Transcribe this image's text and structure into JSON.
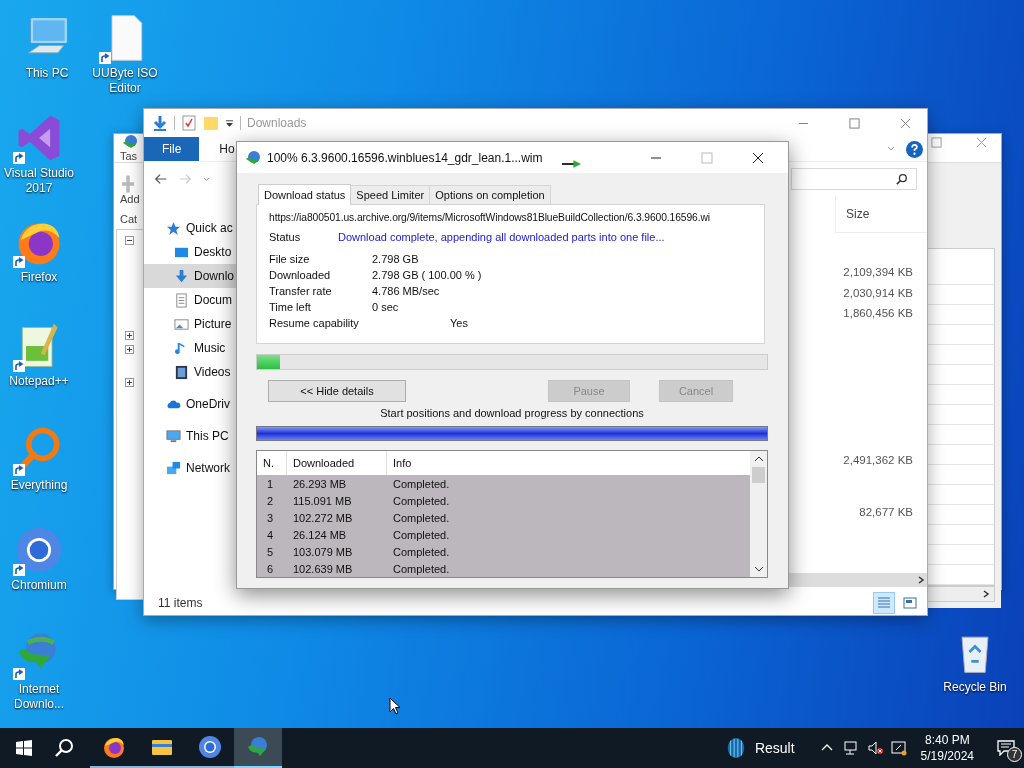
{
  "desktop": {
    "icons": [
      {
        "label": "This PC",
        "kind": "computer",
        "shortcut": false
      },
      {
        "label": "UUByte ISO Editor",
        "kind": "document",
        "shortcut": true
      },
      {
        "label": "Visual Studio 2017",
        "kind": "visual-studio",
        "shortcut": true
      },
      {
        "label": "Firefox",
        "kind": "firefox",
        "shortcut": true
      },
      {
        "label": "Notepad++",
        "kind": "notepad",
        "shortcut": true
      },
      {
        "label": "Everything",
        "kind": "magnifier",
        "shortcut": true
      },
      {
        "label": "Chromium",
        "kind": "chromium",
        "shortcut": true
      },
      {
        "label": "Internet Downlo...",
        "kind": "downloader",
        "shortcut": true
      },
      {
        "label": "Recycle Bin",
        "kind": "recycle-bin",
        "shortcut": false
      }
    ]
  },
  "background_window": {
    "toolbar_label": "Tas",
    "add_label": "Add",
    "categories_label": "Cat",
    "tree_nodes": [
      {
        "expanded": true
      },
      {
        "expanded": false
      },
      {
        "expanded": false
      },
      {
        "expanded": false
      }
    ]
  },
  "explorer": {
    "title": "Downloads",
    "ribbon_tabs": [
      {
        "label": "File",
        "selected": true
      },
      {
        "label": "Ho",
        "selected": false
      }
    ],
    "nav_items": [
      {
        "label": "Quick ac",
        "kind": "star",
        "selected": false
      },
      {
        "label": "Deskto",
        "kind": "desktop",
        "selected": false
      },
      {
        "label": "Downlo",
        "kind": "download",
        "selected": true
      },
      {
        "label": "Docum",
        "kind": "document",
        "selected": false
      },
      {
        "label": "Picture",
        "kind": "pictures",
        "selected": false
      },
      {
        "label": "Music",
        "kind": "music",
        "selected": false
      },
      {
        "label": "Videos",
        "kind": "videos",
        "selected": false
      },
      {
        "label": "OneDriv",
        "kind": "cloud",
        "selected": false
      },
      {
        "label": "This PC",
        "kind": "computer",
        "selected": false
      },
      {
        "label": "Network",
        "kind": "network",
        "selected": false
      }
    ],
    "column_header": "Size",
    "sizes": [
      "2,109,394 KB",
      "2,030,914 KB",
      "1,860,456 KB",
      "2,491,362 KB",
      "82,677 KB"
    ],
    "status": "11 items"
  },
  "dialog": {
    "title": "100% 6.3.9600.16596.winblues14_gdr_lean.1...wim",
    "tabs": [
      {
        "label": "Download status",
        "selected": true
      },
      {
        "label": "Speed Limiter",
        "selected": false
      },
      {
        "label": "Options on completion",
        "selected": false
      }
    ],
    "url": "https://ia800501.us.archive.org/9/items/MicrosoftWindows81BlueBuildCollection/6.3.9600.16596.wi",
    "status_label": "Status",
    "status_value": "Download complete, appending all downloaded parts into one file...",
    "info": [
      {
        "label": "File size",
        "value": "2.798  GB"
      },
      {
        "label": "Downloaded",
        "value": "2.798  GB  ( 100.00 % )"
      },
      {
        "label": "Transfer rate",
        "value": "4.786  MB/sec"
      },
      {
        "label": "Time left",
        "value": "0 sec"
      }
    ],
    "resume_label": "Resume capability",
    "resume_value": "Yes",
    "progress": {
      "level": 0.045
    },
    "buttons": [
      {
        "label": "<< Hide details",
        "disabled": false
      },
      {
        "label": "Pause",
        "disabled": true
      },
      {
        "label": "Cancel",
        "disabled": true
      }
    ],
    "connections_caption": "Start positions and download progress by connections",
    "table": {
      "columns": [
        "N.",
        "Downloaded",
        "Info"
      ],
      "rows": [
        {
          "n": "1",
          "downloaded": "26.293  MB",
          "info": "Completed.",
          "selected": true
        },
        {
          "n": "2",
          "downloaded": "115.091  MB",
          "info": "Completed.",
          "selected": true
        },
        {
          "n": "3",
          "downloaded": "102.272  MB",
          "info": "Completed.",
          "selected": true
        },
        {
          "n": "4",
          "downloaded": "26.124  MB",
          "info": "Completed.",
          "selected": true
        },
        {
          "n": "5",
          "downloaded": "103.079  MB",
          "info": "Completed.",
          "selected": true
        },
        {
          "n": "6",
          "downloaded": "102.639  MB",
          "info": "Completed.",
          "selected": true
        }
      ]
    }
  },
  "taskbar": {
    "apps": [
      {
        "kind": "firefox",
        "active": false,
        "running": true
      },
      {
        "kind": "folder",
        "active": false,
        "running": true
      },
      {
        "kind": "chromium",
        "active": false,
        "running": true
      },
      {
        "kind": "downloader",
        "active": true,
        "running": true
      }
    ],
    "weather": "Result",
    "volume_muted": true,
    "time": "8:40 PM",
    "date": "5/19/2024",
    "notifications": "7"
  }
}
